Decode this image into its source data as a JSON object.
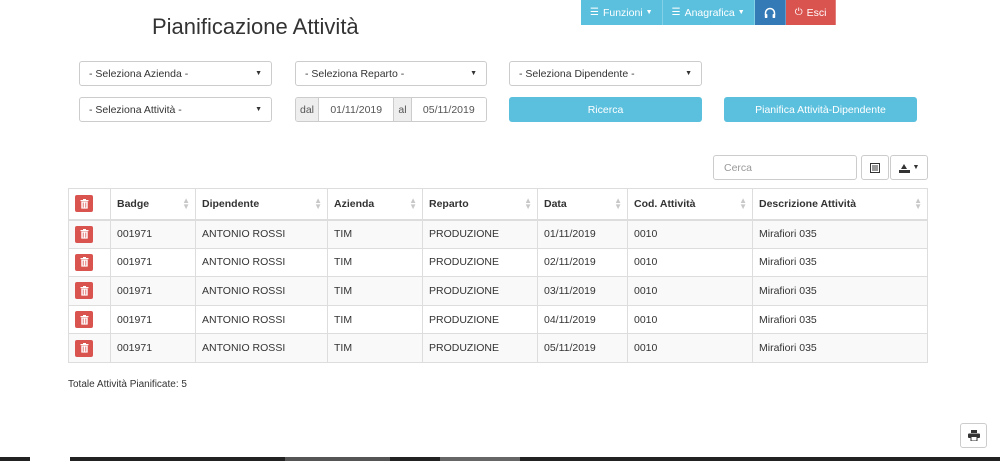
{
  "page": {
    "title": "Pianificazione Attività"
  },
  "nav": {
    "funzioni": "Funzioni",
    "anagrafica": "Anagrafica",
    "esci": "Esci"
  },
  "filters": {
    "azienda": "- Seleziona Azienda -",
    "reparto": "- Seleziona Reparto -",
    "dipendente": "- Seleziona Dipendente -",
    "attivita": "- Seleziona Attività -",
    "dal_label": "dal",
    "dal_value": "01/11/2019",
    "al_label": "al",
    "al_value": "05/11/2019",
    "ricerca": "Ricerca",
    "pianifica": "Pianifica Attività-Dipendente"
  },
  "toolbar": {
    "search_placeholder": "Cerca"
  },
  "table": {
    "columns": [
      "Badge",
      "Dipendente",
      "Azienda",
      "Reparto",
      "Data",
      "Cod. Attività",
      "Descrizione Attività"
    ],
    "rows": [
      [
        "001971",
        "ANTONIO ROSSI",
        "TIM",
        "PRODUZIONE",
        "01/11/2019",
        "0010",
        "Mirafiori 035"
      ],
      [
        "001971",
        "ANTONIO ROSSI",
        "TIM",
        "PRODUZIONE",
        "02/11/2019",
        "0010",
        "Mirafiori 035"
      ],
      [
        "001971",
        "ANTONIO ROSSI",
        "TIM",
        "PRODUZIONE",
        "03/11/2019",
        "0010",
        "Mirafiori 035"
      ],
      [
        "001971",
        "ANTONIO ROSSI",
        "TIM",
        "PRODUZIONE",
        "04/11/2019",
        "0010",
        "Mirafiori 035"
      ],
      [
        "001971",
        "ANTONIO ROSSI",
        "TIM",
        "PRODUZIONE",
        "05/11/2019",
        "0010",
        "Mirafiori 035"
      ]
    ]
  },
  "footer": {
    "total": "Totale Attività Pianificate: 5"
  },
  "colors": {
    "info": "#5bc0de",
    "primary": "#337ab7",
    "danger": "#d9534f"
  }
}
